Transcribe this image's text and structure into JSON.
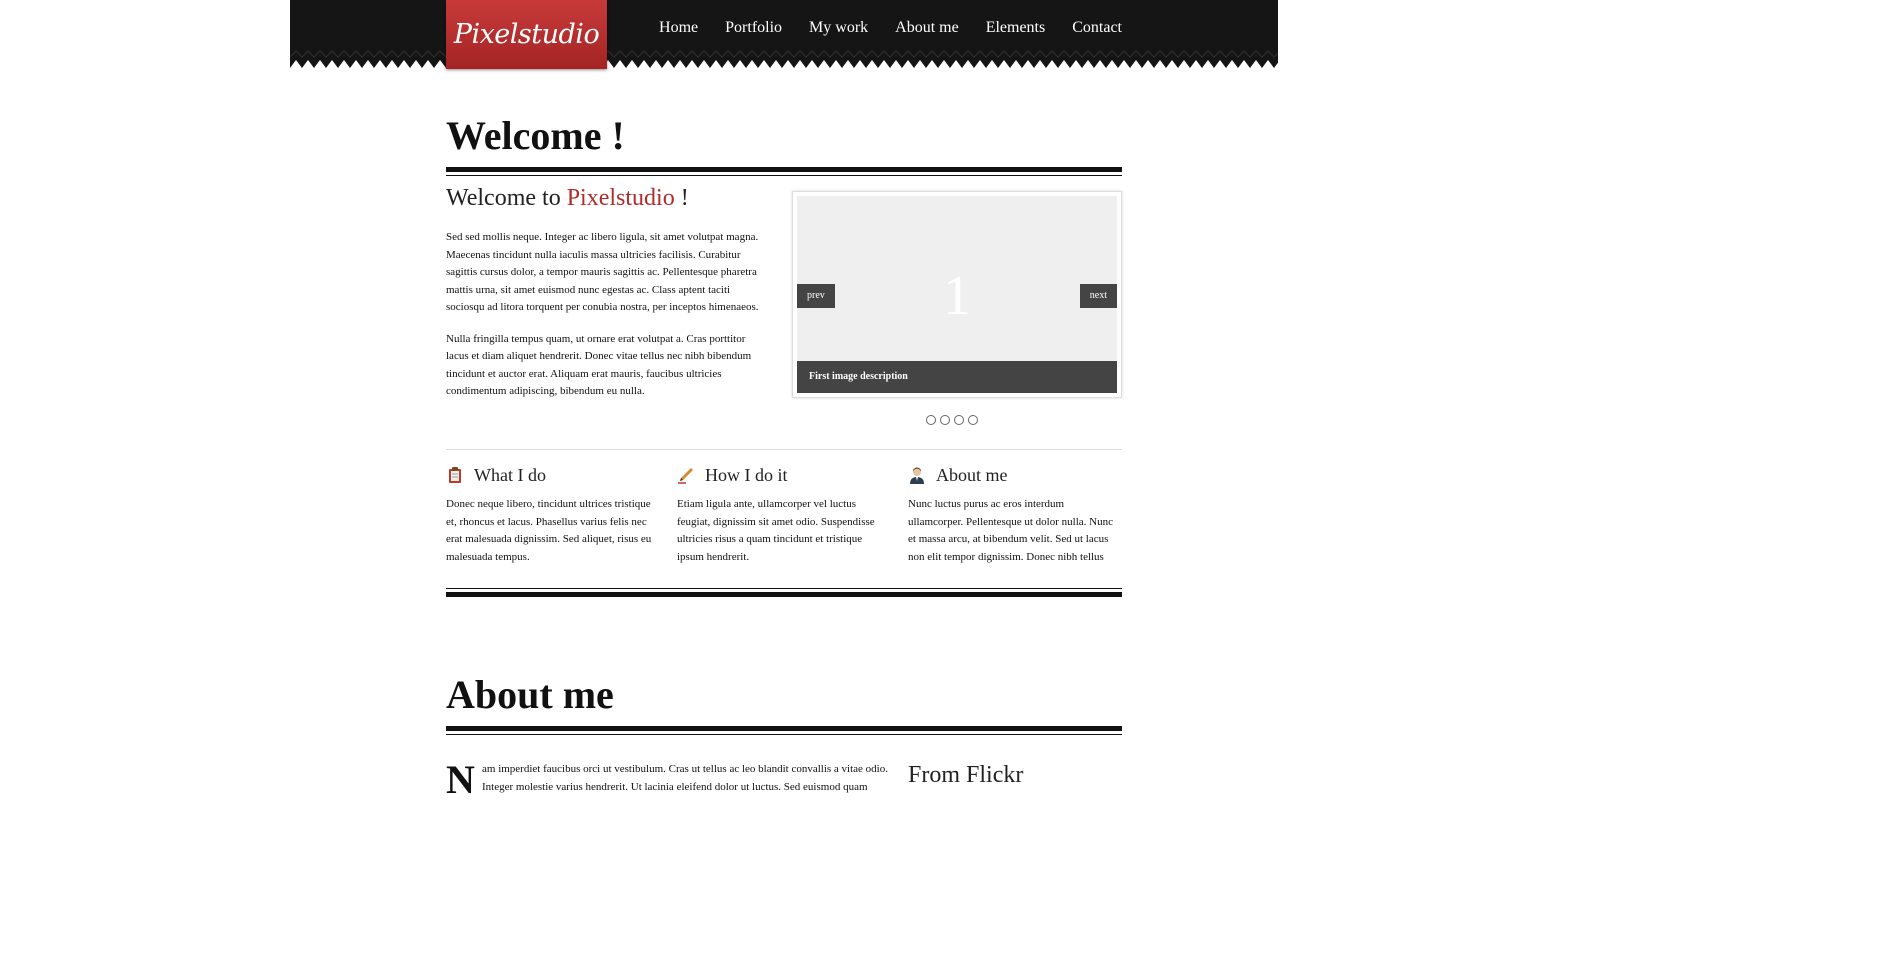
{
  "site": {
    "logo": "Pixelstudio"
  },
  "nav": [
    "Home",
    "Portfolio",
    "My work",
    "About me",
    "Elements",
    "Contact"
  ],
  "welcome": {
    "title": "Welcome !",
    "subtitle_prefix": "Welcome to ",
    "subtitle_accent": "Pixelstudio",
    "subtitle_suffix": " !",
    "paragraph1": "Sed sed mollis neque. Integer ac libero ligula, sit amet volutpat magna. Maecenas tincidunt nulla iaculis massa ultricies facilisis. Curabitur sagittis cursus dolor, a tempor mauris sagittis ac. Pellentesque pharetra mattis urna, sit amet euismod nunc egestas ac. Class aptent taciti sociosqu ad litora torquent per conubia nostra, per inceptos himenaeos.",
    "paragraph2": "Nulla fringilla tempus quam, ut ornare erat volutpat a. Cras porttitor lacus et diam aliquet hendrerit. Donec vitae tellus nec nibh bibendum tincidunt et auctor erat. Aliquam erat mauris, faucibus ultricies condimentum adipiscing, bibendum eu nulla."
  },
  "slider": {
    "number": "1",
    "prev_label": "prev",
    "next_label": "next",
    "caption": "First image description",
    "dot_count": 4
  },
  "features": [
    {
      "icon": "clipboard-icon",
      "title": "What I do",
      "text": "Donec neque libero, tincidunt ultrices tristique et, rhoncus et lacus. Phasellus varius felis nec erat malesuada dignissim. Sed aliquet, risus eu malesuada tempus."
    },
    {
      "icon": "pen-icon",
      "title": "How I do it",
      "text": "Etiam ligula ante, ullamcorper vel luctus feugiat, dignissim sit amet odio. Suspendisse ultricies risus a quam tincidunt et tristique ipsum hendrerit."
    },
    {
      "icon": "person-icon",
      "title": "About me",
      "text": "Nunc luctus purus ac eros interdum ullamcorper. Pellentesque ut dolor nulla. Nunc et massa arcu, at bibendum velit. Sed ut lacus non elit tempor dignissim. Donec nibh tellus"
    }
  ],
  "about": {
    "title": "About me",
    "dropcap": "N",
    "text": "am imperdiet faucibus orci ut vestibulum. Cras ut tellus ac leo blandit convallis a vitae odio. Integer molestie varius hendrerit. Ut lacinia eleifend dolor ut luctus. Sed euismod quam",
    "flickr_title": "From Flickr"
  },
  "colors": {
    "accent": "#b22b2b",
    "header_bg": "#151515",
    "logo_bg": "#b32f2f",
    "slider_bar": "#444444"
  }
}
